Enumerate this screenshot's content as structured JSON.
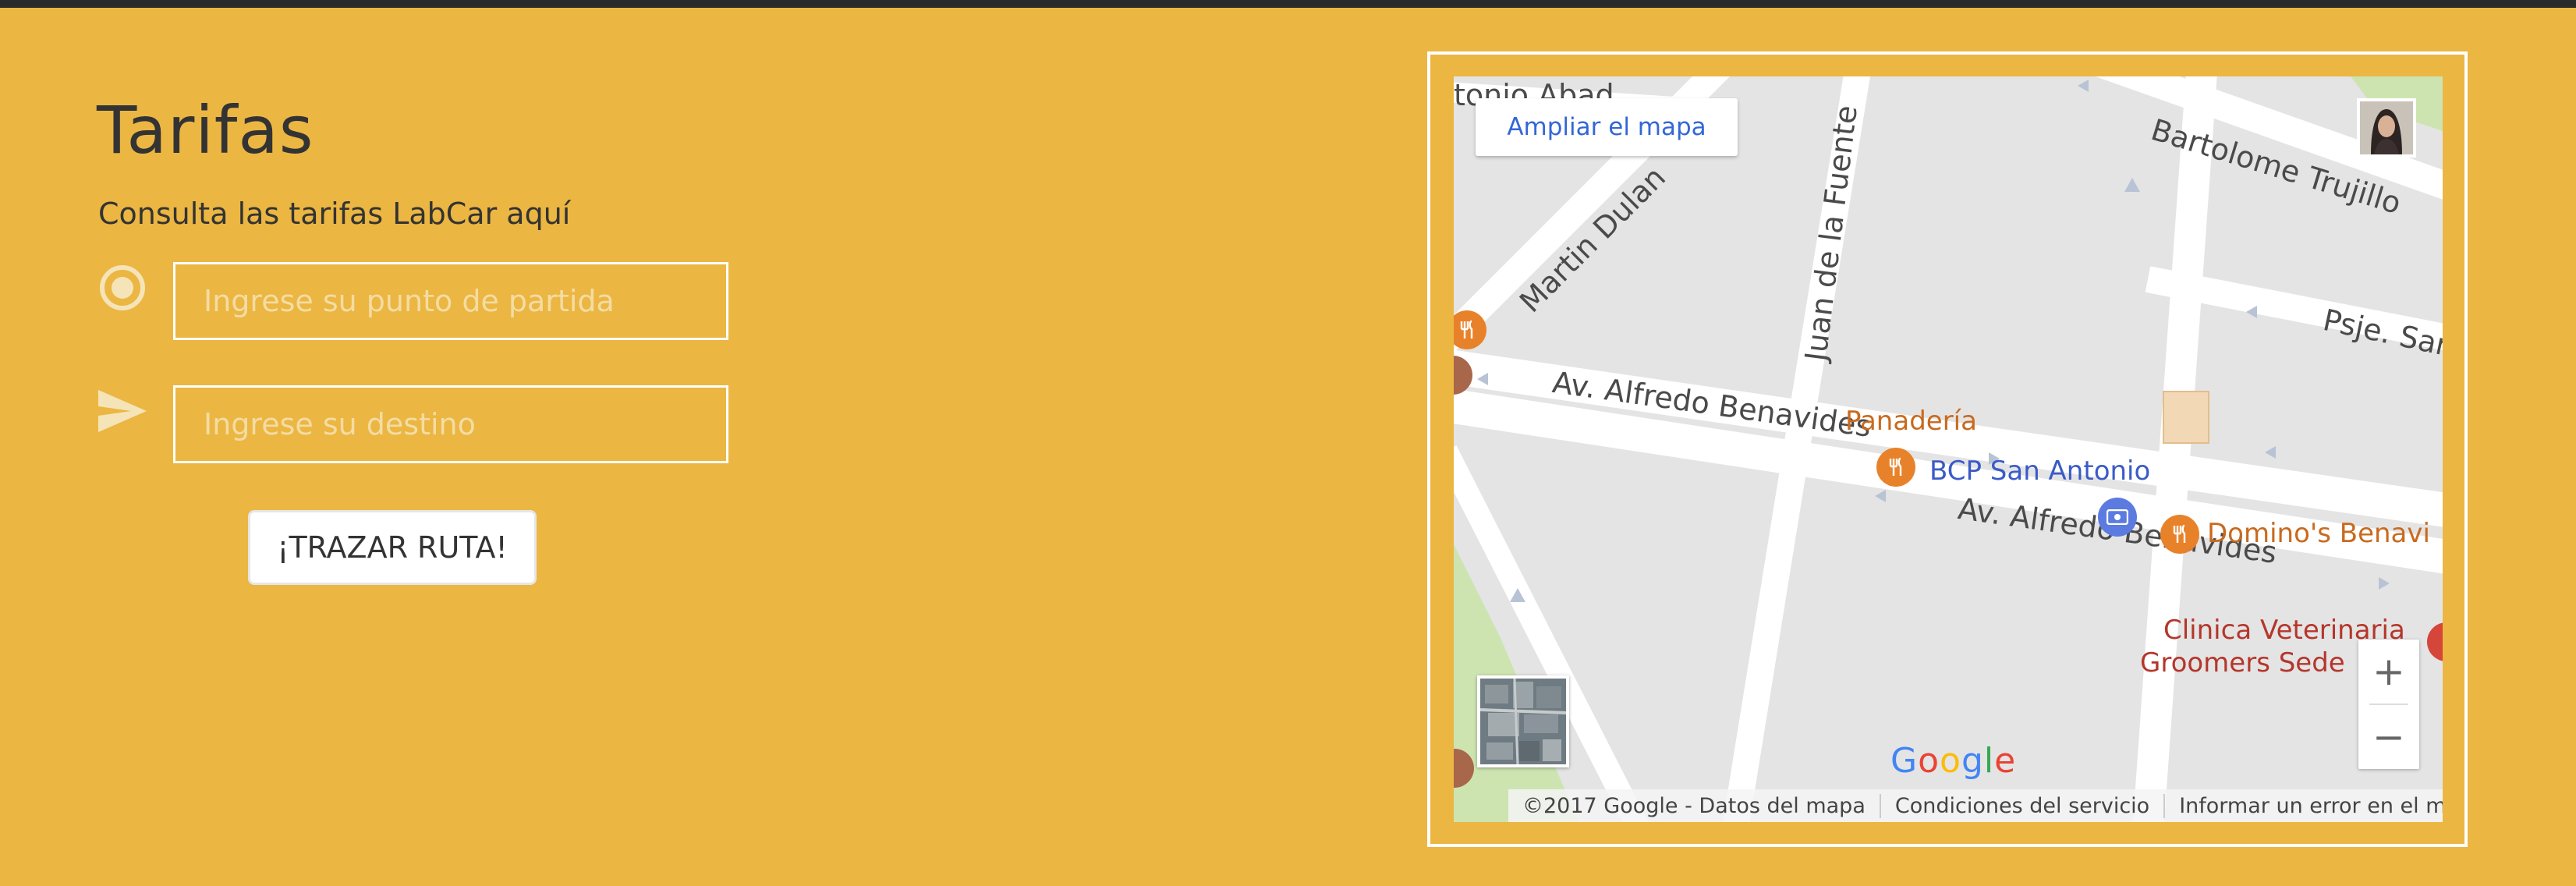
{
  "page": {
    "title": "Tarifas",
    "subtitle": "Consulta las tarifas LabCar aquí"
  },
  "form": {
    "origin": {
      "placeholder": "Ingrese su punto de partida",
      "value": "",
      "icon": "radio-target-icon"
    },
    "destination": {
      "placeholder": "Ingrese su destino",
      "value": "",
      "icon": "send-arrow-icon"
    },
    "submit_label": "¡TRAZAR RUTA!"
  },
  "map": {
    "enlarge_label": "Ampliar el mapa",
    "streets": {
      "antonio_abad": "tonio Abad",
      "martin_dulanto": "Martin Dulan",
      "juan_fuente": "Juan de la Fuente",
      "bartolome": "Bartolome Trujillo",
      "psje": "Psje. San",
      "benavides_1": "Av. Alfredo Benavides",
      "benavides_2": "Av. Alfredo Benavides"
    },
    "pois": {
      "panaderia": "Panadería",
      "bcp": "BCP San Antonio",
      "dominos": "Domino's Benavi",
      "clinica_1": "Clinica Veterinaria",
      "clinica_2": "Groomers Sede"
    },
    "zoom_in": "+",
    "zoom_out": "−",
    "google_logo": [
      "G",
      "o",
      "o",
      "g",
      "l",
      "e"
    ],
    "attribution": {
      "copyright": "©2017 Google - Datos del mapa",
      "terms": "Condiciones del servicio",
      "report": "Informar un error en el mapa"
    }
  },
  "colors": {
    "background": "#ebb642",
    "topbar": "#2b2b2b",
    "map_road": "#ffffff",
    "map_block": "#e4e4e4",
    "map_park": "#cde4b0",
    "poi_orange": "#e8822a",
    "poi_blue": "#5b7be0"
  }
}
